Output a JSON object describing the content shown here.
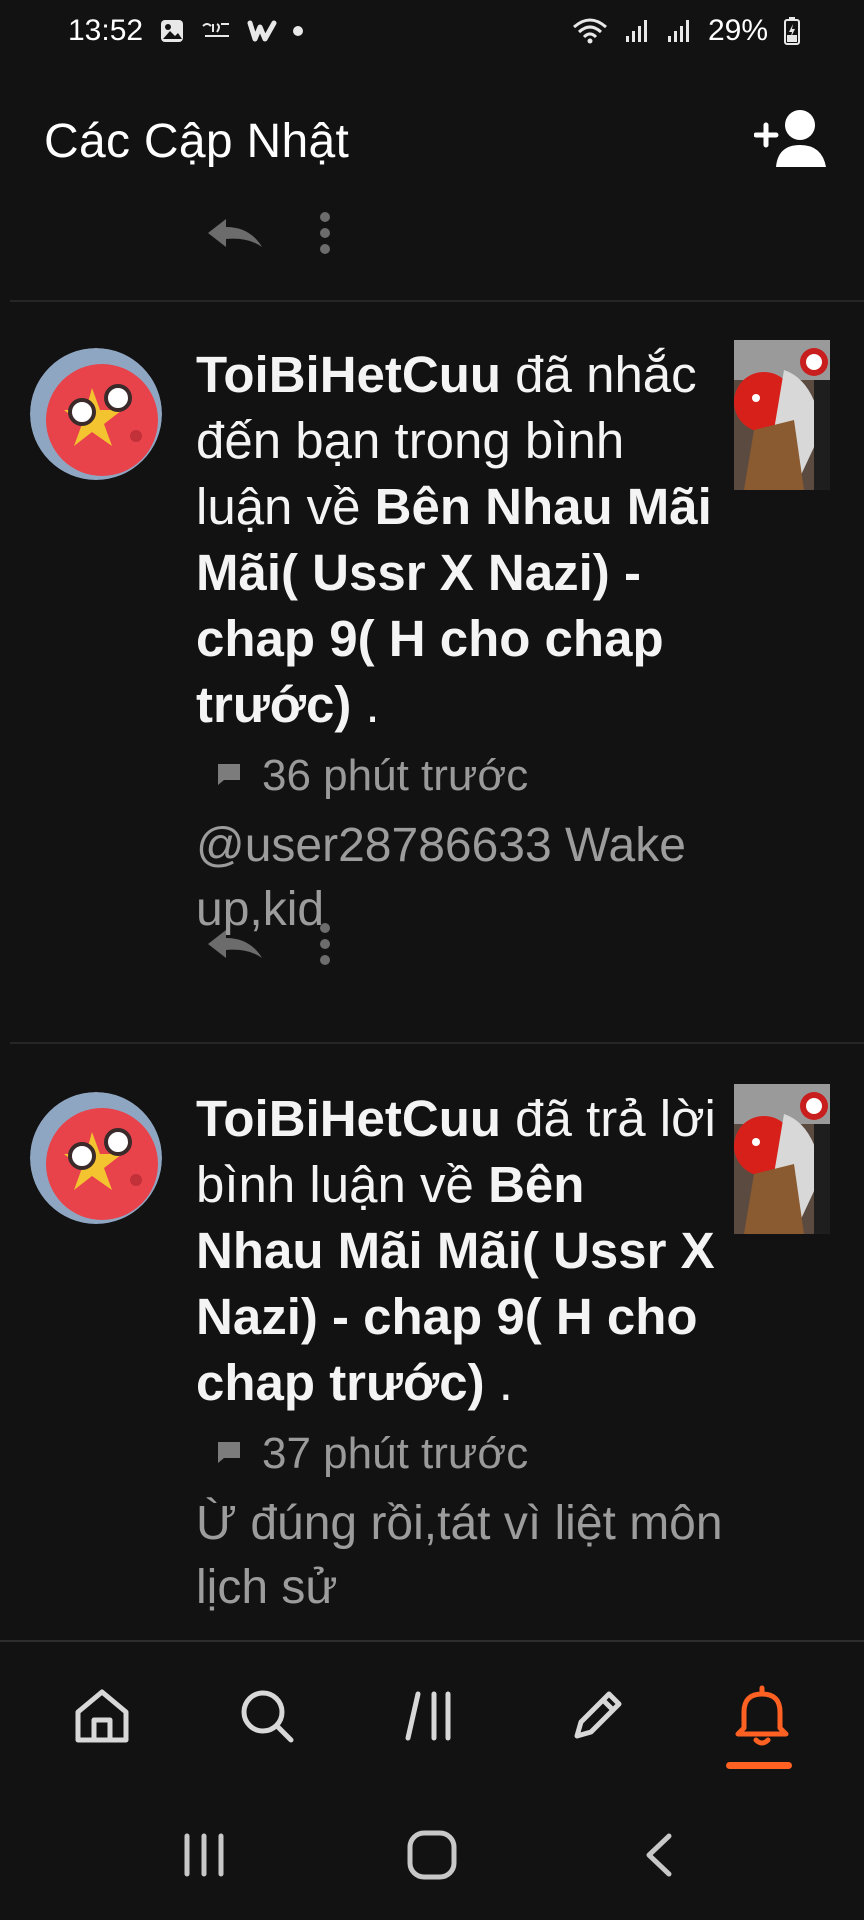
{
  "status_bar": {
    "time": "13:52",
    "battery": "29%",
    "left_icons": [
      "image-icon",
      "carrier-logo-icon",
      "wattpad-w-icon",
      "dot-icon"
    ],
    "right_icons": [
      "wifi-icon",
      "signal-icon",
      "signal-icon",
      "battery-charging-icon"
    ]
  },
  "header": {
    "title": "Các Cập Nhật",
    "action_icon": "add-user-icon"
  },
  "notifications": [
    {
      "user": "ToiBiHetCuu",
      "action": " đã nhắc đến bạn trong bình luận về ",
      "story": "Bên Nhau Mãi Mãi( Ussr X Nazi) - chap 9( H cho chap trước)",
      "suffix": " .",
      "time": "36 phút trước",
      "comment": "@user28786633 Wake up,kid"
    },
    {
      "user": "ToiBiHetCuu",
      "action": " đã trả lời bình luận về ",
      "story": "Bên Nhau Mãi Mãi( Ussr X Nazi) - chap 9( H cho chap trước)",
      "suffix": " .",
      "time": "37 phút trước",
      "comment": "Ừ đúng rồi,tát vì liệt môn lịch sử"
    }
  ],
  "bottom_nav": {
    "items": [
      "home-icon",
      "search-icon",
      "library-icon",
      "write-icon",
      "notifications-bell-icon"
    ],
    "active": "notifications-bell-icon",
    "accent_color": "#ff6122"
  },
  "system_nav": {
    "items": [
      "recent-apps-icon",
      "home-circle-icon",
      "back-icon"
    ]
  },
  "colors": {
    "background": "#121212",
    "primary_text": "#f4f4f4",
    "secondary_text": "#9a9a9a",
    "accent": "#ff6122"
  }
}
